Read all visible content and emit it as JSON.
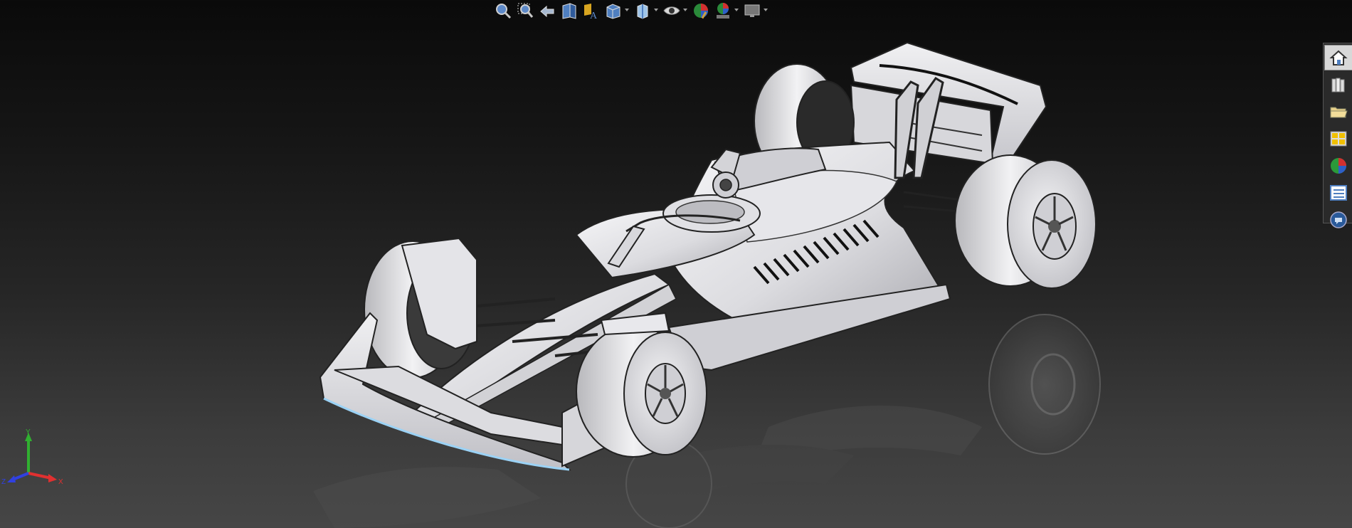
{
  "app": {
    "background_top": "#0a0a0a",
    "background_bottom": "#464646"
  },
  "hud_toolbar": {
    "items": [
      {
        "name": "zoom-to-fit-icon",
        "dropdown": false
      },
      {
        "name": "zoom-to-area-icon",
        "dropdown": false
      },
      {
        "name": "previous-view-icon",
        "dropdown": false
      },
      {
        "name": "section-view-icon",
        "dropdown": false
      },
      {
        "name": "dynamic-annotation-views-icon",
        "dropdown": false
      },
      {
        "name": "view-orientation-icon",
        "dropdown": true
      },
      {
        "name": "display-style-icon",
        "dropdown": true
      },
      {
        "name": "hide-show-items-icon",
        "dropdown": true
      },
      {
        "name": "edit-appearance-icon",
        "dropdown": false
      },
      {
        "name": "apply-scene-icon",
        "dropdown": true
      },
      {
        "name": "view-settings-icon",
        "dropdown": true
      }
    ]
  },
  "task_pane": {
    "tabs": [
      {
        "name": "solidworks-resources-icon",
        "active": true
      },
      {
        "name": "design-library-icon",
        "active": false
      },
      {
        "name": "file-explorer-icon",
        "active": false
      },
      {
        "name": "view-palette-icon",
        "active": false
      },
      {
        "name": "appearances-scenes-icon",
        "active": false
      },
      {
        "name": "custom-properties-icon",
        "active": false
      },
      {
        "name": "solidworks-forum-icon",
        "active": false
      }
    ]
  },
  "triad": {
    "x_label": "X",
    "y_label": "Y",
    "z_label": "Z",
    "x_color": "#e03030",
    "y_color": "#30b030",
    "z_color": "#3040e0"
  },
  "model": {
    "description_color": "#e8e8ec"
  }
}
